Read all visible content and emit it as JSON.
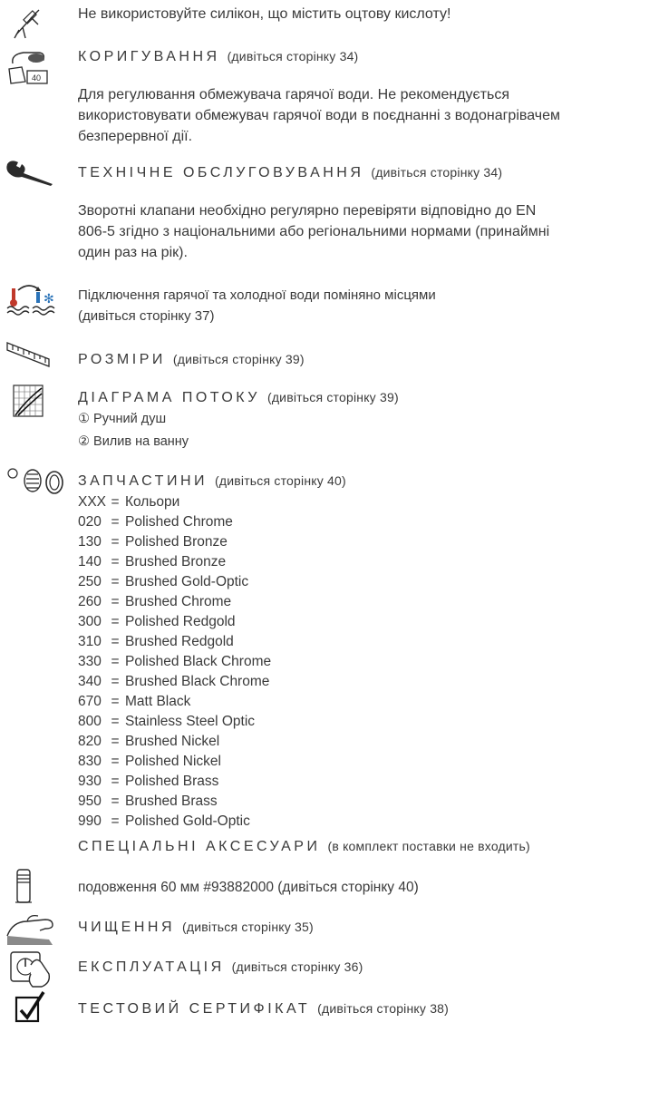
{
  "warning": {
    "text": "Не використовуйте силікон, що містить оцтову кислоту!"
  },
  "adjustment": {
    "heading": "КОРИГУВАННЯ",
    "ref": "(дивіться сторінку 34)",
    "icon_label": "40",
    "lines": [
      "Для регулювання обмежувача гарячої води. Не рекомендується",
      "використовувати обмежувач гарячої води в поєднанні з водонагрівачем",
      "безперервної дії."
    ]
  },
  "maintenance": {
    "heading": "ТЕХНІЧНЕ ОБСЛУГОВУВАННЯ",
    "ref": "(дивіться сторінку 34)",
    "lines": [
      "Зворотні клапани необхідно регулярно перевіряти відповідно до EN",
      "806-5 згідно з національними або регіональними нормами (принаймні",
      "один раз на рік)."
    ]
  },
  "connection": {
    "lines": [
      "Підключення гарячої та холодної води поміняно місцями",
      "(дивіться сторінку 37)"
    ]
  },
  "dimensions": {
    "heading": "РОЗМІРИ",
    "ref": "(дивіться сторінку 39)"
  },
  "flow": {
    "heading": "ДІАГРАМА ПОТОКУ",
    "ref": "(дивіться сторінку 39)",
    "items": [
      "① Ручний душ",
      "② Вилив на ванну"
    ]
  },
  "spare_parts": {
    "heading": "ЗАПЧАСТИНИ",
    "ref": "(дивіться сторінку 40)",
    "items": [
      {
        "code": "XXX",
        "name": "Кольори"
      },
      {
        "code": "020",
        "name": "Polished Chrome"
      },
      {
        "code": "130",
        "name": "Polished Bronze"
      },
      {
        "code": "140",
        "name": "Brushed Bronze"
      },
      {
        "code": "250",
        "name": "Brushed Gold-Optic"
      },
      {
        "code": "260",
        "name": "Brushed Chrome"
      },
      {
        "code": "300",
        "name": "Polished Redgold"
      },
      {
        "code": "310",
        "name": "Brushed Redgold"
      },
      {
        "code": "330",
        "name": "Polished Black Chrome"
      },
      {
        "code": "340",
        "name": "Brushed Black Chrome"
      },
      {
        "code": "670",
        "name": "Matt Black"
      },
      {
        "code": "800",
        "name": "Stainless Steel Optic"
      },
      {
        "code": "820",
        "name": "Brushed Nickel"
      },
      {
        "code": "830",
        "name": "Polished Nickel"
      },
      {
        "code": "930",
        "name": "Polished Brass"
      },
      {
        "code": "950",
        "name": "Brushed Brass"
      },
      {
        "code": "990",
        "name": "Polished Gold-Optic"
      }
    ]
  },
  "accessories": {
    "heading": "СПЕЦІАЛЬНІ АКСЕСУАРИ",
    "ref": "(в комплект поставки не входить)",
    "extension": "подовження 60 мм #93882000 (дивіться сторінку 40)"
  },
  "cleaning": {
    "heading": "ЧИЩЕННЯ",
    "ref": "(дивіться сторінку 35)"
  },
  "operation": {
    "heading": "ЕКСПЛУАТАЦІЯ",
    "ref": "(дивіться сторінку 36)"
  },
  "certificate": {
    "heading": "ТЕСТОВИЙ СЕРТИФІКАТ",
    "ref": "(дивіться сторінку 38)"
  },
  "colors": {
    "text": "#3a3a3a",
    "icon": "#2b2b2b",
    "hot": "#c0392b",
    "cold": "#2a73b8"
  }
}
